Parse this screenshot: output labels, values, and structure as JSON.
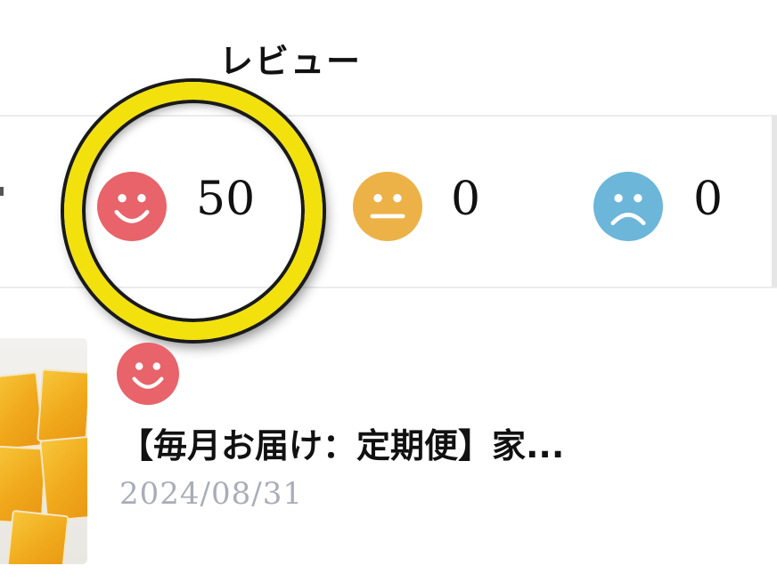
{
  "caption": "レビュー",
  "summary": {
    "good": {
      "icon": "smile-face-icon",
      "color": "#e8636a",
      "count": "50"
    },
    "neutral": {
      "icon": "neutral-face-icon",
      "color": "#ecb248",
      "count": "0"
    },
    "bad": {
      "icon": "sad-face-icon",
      "color": "#6cb6d9",
      "count": "0"
    }
  },
  "highlight": {
    "color": "#f3e10e"
  },
  "reviews": [
    {
      "rating_icon": "smile-face-icon",
      "title": "【毎月お届け：定期便】家...",
      "date": "2024/08/31"
    }
  ]
}
